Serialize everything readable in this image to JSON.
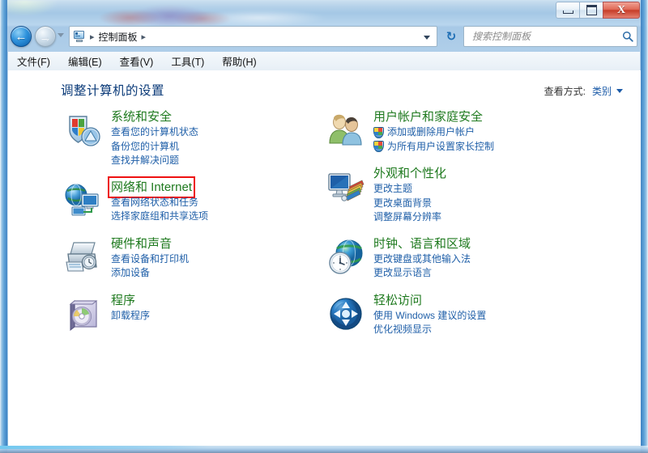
{
  "window": {
    "caption_buttons": [
      {
        "name": "minimize",
        "glyph": "minimize-icon"
      },
      {
        "name": "maximize",
        "glyph": "maximize-icon"
      },
      {
        "name": "close",
        "glyph": "X"
      }
    ]
  },
  "navbar": {
    "back_glyph": "←",
    "forward_glyph": "→",
    "history_dropdown": "chevron-down-icon",
    "address_icon": "control-panel-icon",
    "breadcrumbs": [
      "控制面板"
    ],
    "separator": "▸",
    "refresh_glyph": "↻",
    "search": {
      "placeholder": "搜索控制面板",
      "value": "",
      "icon": "search-icon"
    }
  },
  "menubar": {
    "items": [
      {
        "label": "文件(F)"
      },
      {
        "label": "编辑(E)"
      },
      {
        "label": "查看(V)"
      },
      {
        "label": "工具(T)"
      },
      {
        "label": "帮助(H)"
      }
    ]
  },
  "content": {
    "page_title": "调整计算机的设置",
    "view_by": {
      "label": "查看方式:",
      "value": "类别",
      "caret": "chevron-down-icon"
    },
    "left_column": [
      {
        "id": "system-and-security",
        "title": "系统和安全",
        "icon": "security-shield-icon",
        "highlighted": false,
        "links": [
          {
            "text": "查看您的计算机状态",
            "shield": false
          },
          {
            "text": "备份您的计算机",
            "shield": false
          },
          {
            "text": "查找并解决问题",
            "shield": false
          }
        ]
      },
      {
        "id": "network-and-internet",
        "title": "网络和 Internet",
        "icon": "network-globe-icon",
        "highlighted": true,
        "links": [
          {
            "text": "查看网络状态和任务",
            "shield": false
          },
          {
            "text": "选择家庭组和共享选项",
            "shield": false
          }
        ]
      },
      {
        "id": "hardware-and-sound",
        "title": "硬件和声音",
        "icon": "printer-icon",
        "highlighted": false,
        "links": [
          {
            "text": "查看设备和打印机",
            "shield": false
          },
          {
            "text": "添加设备",
            "shield": false
          }
        ]
      },
      {
        "id": "programs",
        "title": "程序",
        "icon": "programs-disc-icon",
        "highlighted": false,
        "links": [
          {
            "text": "卸载程序",
            "shield": false
          }
        ]
      }
    ],
    "right_column": [
      {
        "id": "user-accounts-and-family-safety",
        "title": "用户帐户和家庭安全",
        "icon": "users-icon",
        "highlighted": false,
        "links": [
          {
            "text": "添加或删除用户帐户",
            "shield": true
          },
          {
            "text": "为所有用户设置家长控制",
            "shield": true
          }
        ]
      },
      {
        "id": "appearance-and-personalization",
        "title": "外观和个性化",
        "icon": "appearance-monitor-icon",
        "highlighted": false,
        "links": [
          {
            "text": "更改主题",
            "shield": false
          },
          {
            "text": "更改桌面背景",
            "shield": false
          },
          {
            "text": "调整屏幕分辨率",
            "shield": false
          }
        ]
      },
      {
        "id": "clock-language-and-region",
        "title": "时钟、语言和区域",
        "icon": "clock-globe-icon",
        "highlighted": false,
        "links": [
          {
            "text": "更改键盘或其他输入法",
            "shield": false
          },
          {
            "text": "更改显示语言",
            "shield": false
          }
        ]
      },
      {
        "id": "ease-of-access",
        "title": "轻松访问",
        "icon": "ease-of-access-icon",
        "highlighted": false,
        "links": [
          {
            "text": "使用 Windows 建议的设置",
            "shield": false
          },
          {
            "text": "优化视频显示",
            "shield": false
          }
        ]
      }
    ]
  },
  "colors": {
    "category_title": "#1f7a1f",
    "link": "#1f5fa8",
    "page_title": "#0a3a78",
    "highlight_box": "#ee1111",
    "close_button": "#c63d28"
  }
}
